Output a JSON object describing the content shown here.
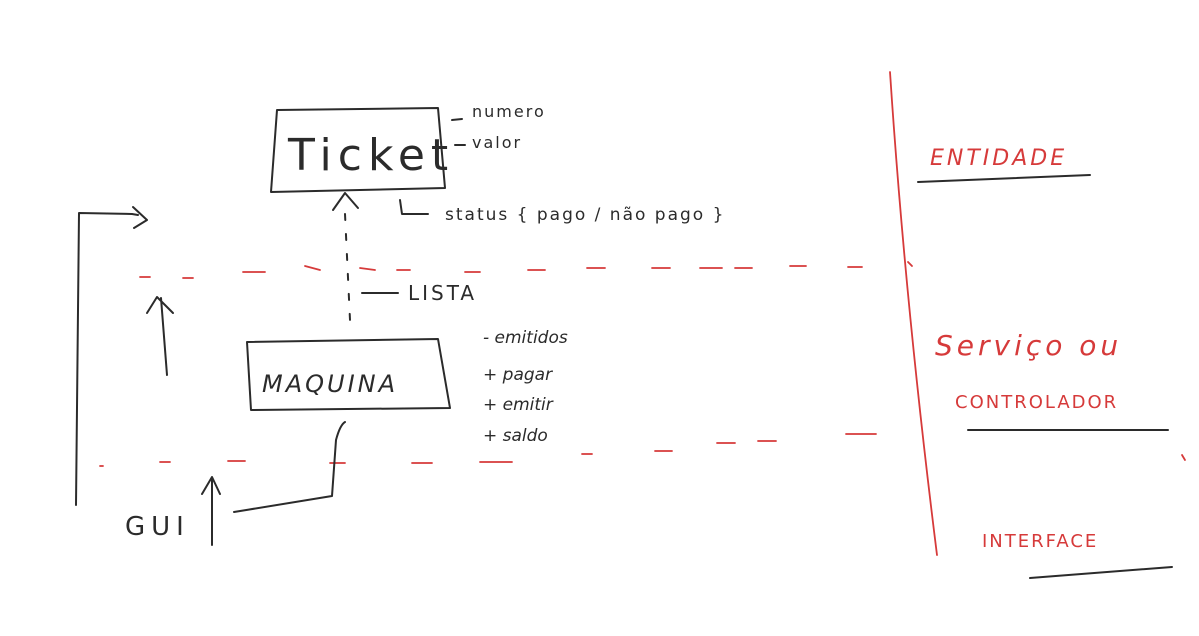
{
  "classes": {
    "ticket": {
      "name": "Ticket",
      "attributes": [
        "numero",
        "valor"
      ],
      "status_note": "status { pago / não pago }"
    },
    "maquina": {
      "name": "MAQUINA",
      "members": [
        "- emitidos",
        "+ pagar",
        "+ emitir",
        "+ saldo"
      ]
    }
  },
  "relation_label": "LISTA",
  "gui_label": "GUI",
  "layers": {
    "entity": "ENTIDADE",
    "service": "Serviço ou",
    "controller": "CONTROLADOR",
    "interface": "INTERFACE"
  },
  "colors": {
    "ink": "#2b2b2b",
    "red": "#d63a3a"
  }
}
